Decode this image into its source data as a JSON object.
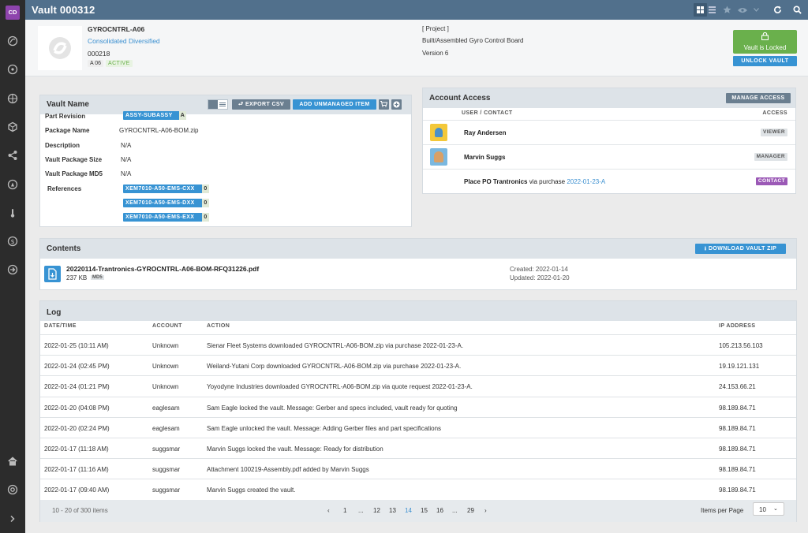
{
  "nav": {
    "avatar": "CD"
  },
  "topbar": {
    "title": "Vault 000312"
  },
  "header": {
    "vault_code": "GYROCNTRL-A06",
    "company": "Consolidated Diversified",
    "number": "000218",
    "rev_badge": "A 06",
    "status_badge": "ACTIVE",
    "project_tag": "[ Project ]",
    "project_desc": "Built/Assembled Gyro Control Board",
    "version": "Version 6",
    "locked_label": "Vault is Locked",
    "unlock_label": "UNLOCK VAULT"
  },
  "vault_panel": {
    "title": "Vault Name",
    "export_label": "EXPORT CSV",
    "add_label": "ADD UNMANAGED ITEM",
    "fields": [
      {
        "label": "Part Revision",
        "chip": "ASSY-SUBASSY",
        "chip_count": "A"
      },
      {
        "label": "Package Name",
        "value": "GYROCNTRL-A06-BOM.zip"
      },
      {
        "label": "Description",
        "value": "N/A"
      },
      {
        "label": "Vault Package Size",
        "value": "N/A"
      },
      {
        "label": "Vault Package MD5",
        "value": "N/A"
      },
      {
        "label": "References"
      }
    ],
    "references": [
      {
        "name": "XEM7010-A50-EMS-CXX",
        "count": "0"
      },
      {
        "name": "XEM7010-A50-EMS-DXX",
        "count": "0"
      },
      {
        "name": "XEM7010-A50-EMS-EXX",
        "count": "0"
      }
    ]
  },
  "access_panel": {
    "title": "Account Access",
    "manage_label": "MANAGE ACCESS",
    "col_user": "USER / CONTACT",
    "col_access": "ACCESS",
    "rows": [
      {
        "name": "Ray Andersen",
        "badge": "VIEWER",
        "badge_color": "#dfe3e6"
      },
      {
        "name": "Marvin Suggs",
        "badge": "MANAGER",
        "badge_color": "#dfe3e6"
      },
      {
        "name": "Place PO Trantronics",
        "via": "via purchase",
        "link": "2022-01-23-A",
        "badge": "CONTACT",
        "badge_color": "#9b59b6"
      }
    ]
  },
  "contents_panel": {
    "title": "Contents",
    "download_label": "DOWNLOAD VAULT ZIP",
    "file": {
      "name": "20220114-Trantronics-GYROCNTRL-A06-BOM-RFQ31226.pdf",
      "size": "237 KB",
      "md5_tag": "MD5",
      "created": "Created: 2022-01-14",
      "updated": "Updated: 2022-01-20"
    }
  },
  "log_panel": {
    "title": "Log",
    "columns": [
      "DATE/TIME",
      "ACCOUNT",
      "ACTION",
      "IP ADDRESS"
    ],
    "rows": [
      {
        "date": "2022-01-25 (10:11 AM)",
        "account": "Unknown",
        "action": "Sienar Fleet Systems downloaded GYROCNTRL-A06-BOM.zip via purchase ",
        "link": "2022-01-23-A",
        "after": ".",
        "ip": "105.213.56.103"
      },
      {
        "date": "2022-01-24 (02:45 PM)",
        "account": "Unknown",
        "action": "Weiland-Yutani Corp downloaded GYROCNTRL-A06-BOM.zip via purchase ",
        "link": "2022-01-23-A",
        "after": ".",
        "ip": "19.19.121.131"
      },
      {
        "date": "2022-01-24 (01:21 PM)",
        "account": "Unknown",
        "action": "Yoyodyne Industries downloaded GYROCNTRL-A06-BOM.zip via quote request ",
        "link": "2022-01-23-A",
        "after": ".",
        "ip": "24.153.66.21"
      },
      {
        "date": "2022-01-20 (04:08 PM)",
        "account": "eaglesam",
        "action": "Sam Eagle locked the vault. Message: Gerber and specs included, vault ready for quoting",
        "link": "",
        "after": "",
        "ip": "98.189.84.71"
      },
      {
        "date": "2022-01-20 (02:24 PM)",
        "account": "eaglesam",
        "action": "Sam Eagle unlocked the vault. Message: Adding Gerber files and part specifications",
        "link": "",
        "after": "",
        "ip": "98.189.84.71"
      },
      {
        "date": "2022-01-17 (11:18 AM)",
        "account": "suggsmar",
        "action": "Marvin Suggs locked the vault. Message: Ready for distribution",
        "link": "",
        "after": "",
        "ip": "98.189.84.71"
      },
      {
        "date": "2022-01-17 (11:16 AM)",
        "account": "suggsmar",
        "action": "Attachment 100219-Assembly.pdf added by Marvin Suggs",
        "link": "",
        "after": "",
        "ip": "98.189.84.71"
      },
      {
        "date": "2022-01-17 (09:40 AM)",
        "account": "suggsmar",
        "action": "Marvin Suggs created the vault.",
        "link": "",
        "after": "",
        "ip": "98.189.84.71"
      }
    ],
    "pagination": {
      "summary": "10 - 20 of 300 items",
      "pages": [
        "1",
        "...",
        "12",
        "13",
        "14",
        "15",
        "16",
        "...",
        "29"
      ],
      "current": "14",
      "items_per_page_label": "Items per Page",
      "items_per_page": "10"
    }
  },
  "colors": {
    "accent": "#3793d3",
    "topbar": "#51708c",
    "locked": "#6ab04c",
    "contact": "#9b59b6",
    "link": "#3a8fd0"
  }
}
